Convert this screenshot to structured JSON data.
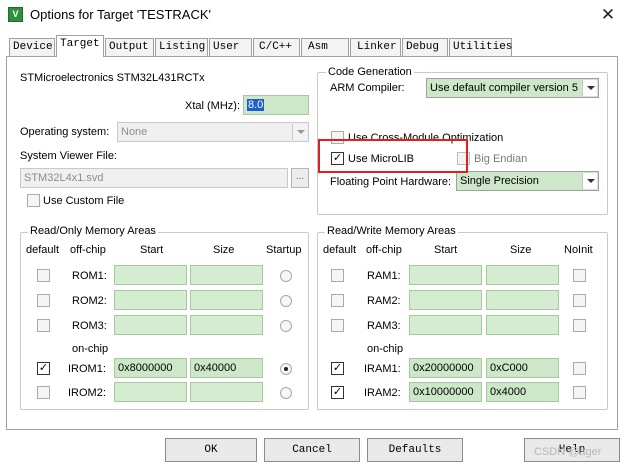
{
  "window": {
    "title": "Options for Target 'TESTRACK'",
    "app_icon_text": "V"
  },
  "tabs": [
    "Device",
    "Target",
    "Output",
    "Listing",
    "User",
    "C/C++",
    "Asm",
    "Linker",
    "Debug",
    "Utilities"
  ],
  "target": {
    "device_name": "STMicroelectronics STM32L431RCTx",
    "xtal_label": "Xtal (MHz):",
    "xtal_value": "8.0",
    "os_label": "Operating system:",
    "os_value": "None",
    "svf_label": "System Viewer File:",
    "svf_value": "STM32L4x1.svd",
    "browse_label": "...",
    "custom_file_label": "Use Custom File"
  },
  "code_gen": {
    "title": "Code Generation",
    "compiler_label": "ARM Compiler:",
    "compiler_value": "Use default compiler version 5",
    "cross_module_label": "Use Cross-Module Optimization",
    "microlib_label": "Use MicroLIB",
    "big_endian_label": "Big Endian",
    "fph_label": "Floating Point Hardware:",
    "fph_value": "Single Precision"
  },
  "rom": {
    "title": "Read/Only Memory Areas",
    "headers": {
      "default": "default",
      "offchip": "off-chip",
      "start": "Start",
      "size": "Size",
      "startup": "Startup"
    },
    "onchip_label": "on-chip",
    "rows": [
      {
        "name": "ROM1:",
        "start": "",
        "size": "",
        "default": false,
        "startup": false
      },
      {
        "name": "ROM2:",
        "start": "",
        "size": "",
        "default": false,
        "startup": false
      },
      {
        "name": "ROM3:",
        "start": "",
        "size": "",
        "default": false,
        "startup": false
      },
      {
        "name": "IROM1:",
        "start": "0x8000000",
        "size": "0x40000",
        "default": true,
        "startup": true
      },
      {
        "name": "IROM2:",
        "start": "",
        "size": "",
        "default": false,
        "startup": false
      }
    ]
  },
  "ram": {
    "title": "Read/Write Memory Areas",
    "headers": {
      "default": "default",
      "offchip": "off-chip",
      "start": "Start",
      "size": "Size",
      "noinit": "NoInit"
    },
    "onchip_label": "on-chip",
    "rows": [
      {
        "name": "RAM1:",
        "start": "",
        "size": "",
        "default": false,
        "noinit": false
      },
      {
        "name": "RAM2:",
        "start": "",
        "size": "",
        "default": false,
        "noinit": false
      },
      {
        "name": "RAM3:",
        "start": "",
        "size": "",
        "default": false,
        "noinit": false
      },
      {
        "name": "IRAM1:",
        "start": "0x20000000",
        "size": "0xC000",
        "default": true,
        "noinit": false
      },
      {
        "name": "IRAM2:",
        "start": "0x10000000",
        "size": "0x4000",
        "default": true,
        "noinit": false
      }
    ]
  },
  "buttons": {
    "ok": "OK",
    "cancel": "Cancel",
    "defaults": "Defaults",
    "help": "Help"
  },
  "watermark": "CSDN @ager",
  "colors": {
    "field_bg": "#cde8c8",
    "highlight_border": "#e02020",
    "titlebar_icon": "#2f8f3b"
  }
}
